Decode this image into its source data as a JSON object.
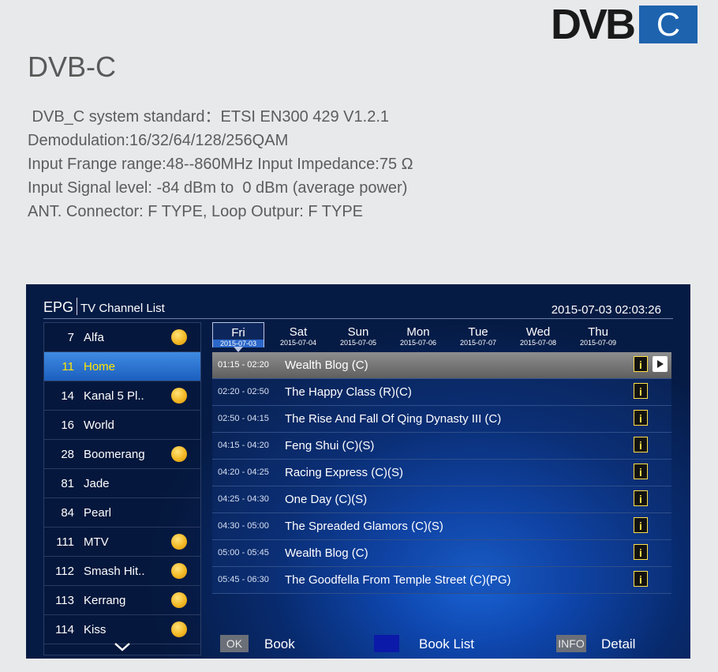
{
  "logo": {
    "text": "DVB",
    "box_text": "C",
    "box_color": "#1d63ae"
  },
  "page": {
    "title": "DVB-C",
    "specs": [
      " DVB_C system standard：ETSI EN300 429 V1.2.1",
      "Demodulation:16/32/64/128/256QAM",
      "Input Frange range:48--860MHz Input Impedance:75 Ω",
      "Input Signal level: -84 dBm to  0 dBm (average power)",
      "ANT. Connector: F TYPE, Loop Outpur: F TYPE"
    ]
  },
  "tv": {
    "header": {
      "epg": "EPG",
      "subtitle": "TV Channel List",
      "clock": "2015-07-03 02:03:26"
    },
    "channels": [
      {
        "num": "7",
        "name": "Alfa",
        "coin": true,
        "selected": false
      },
      {
        "num": "11",
        "name": "Home",
        "coin": false,
        "selected": true
      },
      {
        "num": "14",
        "name": "Kanal 5 Pl..",
        "coin": true,
        "selected": false
      },
      {
        "num": "16",
        "name": "World",
        "coin": false,
        "selected": false
      },
      {
        "num": "28",
        "name": "Boomerang",
        "coin": true,
        "selected": false
      },
      {
        "num": "81",
        "name": "Jade",
        "coin": false,
        "selected": false
      },
      {
        "num": "84",
        "name": "Pearl",
        "coin": false,
        "selected": false
      },
      {
        "num": "111",
        "name": "MTV",
        "coin": true,
        "selected": false
      },
      {
        "num": "112",
        "name": "Smash Hit..",
        "coin": true,
        "selected": false
      },
      {
        "num": "113",
        "name": "Kerrang",
        "coin": true,
        "selected": false
      },
      {
        "num": "114",
        "name": "Kiss",
        "coin": true,
        "selected": false
      }
    ],
    "days": [
      {
        "name": "Fri",
        "date": "2015-07-03",
        "selected": true
      },
      {
        "name": "Sat",
        "date": "2015-07-04",
        "selected": false
      },
      {
        "name": "Sun",
        "date": "2015-07-05",
        "selected": false
      },
      {
        "name": "Mon",
        "date": "2015-07-06",
        "selected": false
      },
      {
        "name": "Tue",
        "date": "2015-07-07",
        "selected": false
      },
      {
        "name": "Wed",
        "date": "2015-07-08",
        "selected": false
      },
      {
        "name": "Thu",
        "date": "2015-07-09",
        "selected": false
      }
    ],
    "programs": [
      {
        "time": "01:15 - 02:20",
        "title": "Wealth Blog (C)",
        "selected": true
      },
      {
        "time": "02:20 - 02:50",
        "title": "The Happy Class (R)(C)",
        "selected": false
      },
      {
        "time": "02:50 - 04:15",
        "title": "The Rise And Fall Of Qing Dynasty III (C)",
        "selected": false
      },
      {
        "time": "04:15 - 04:20",
        "title": "Feng Shui (C)(S)",
        "selected": false
      },
      {
        "time": "04:20 - 04:25",
        "title": "Racing Express (C)(S)",
        "selected": false
      },
      {
        "time": "04:25 - 04:30",
        "title": "One Day (C)(S)",
        "selected": false
      },
      {
        "time": "04:30 - 05:00",
        "title": "The Spreaded Glamors (C)(S)",
        "selected": false
      },
      {
        "time": "05:00 - 05:45",
        "title": "Wealth Blog (C)",
        "selected": false
      },
      {
        "time": "05:45 - 06:30",
        "title": "The Goodfella From Temple Street (C)(PG)",
        "selected": false
      }
    ],
    "info_label": "i",
    "legend": {
      "ok_key": "OK",
      "ok_label": "Book",
      "blue_label": "Book List",
      "blue_color": "#0b1aa8",
      "info_key": "INFO",
      "info_label": "Detail"
    }
  }
}
